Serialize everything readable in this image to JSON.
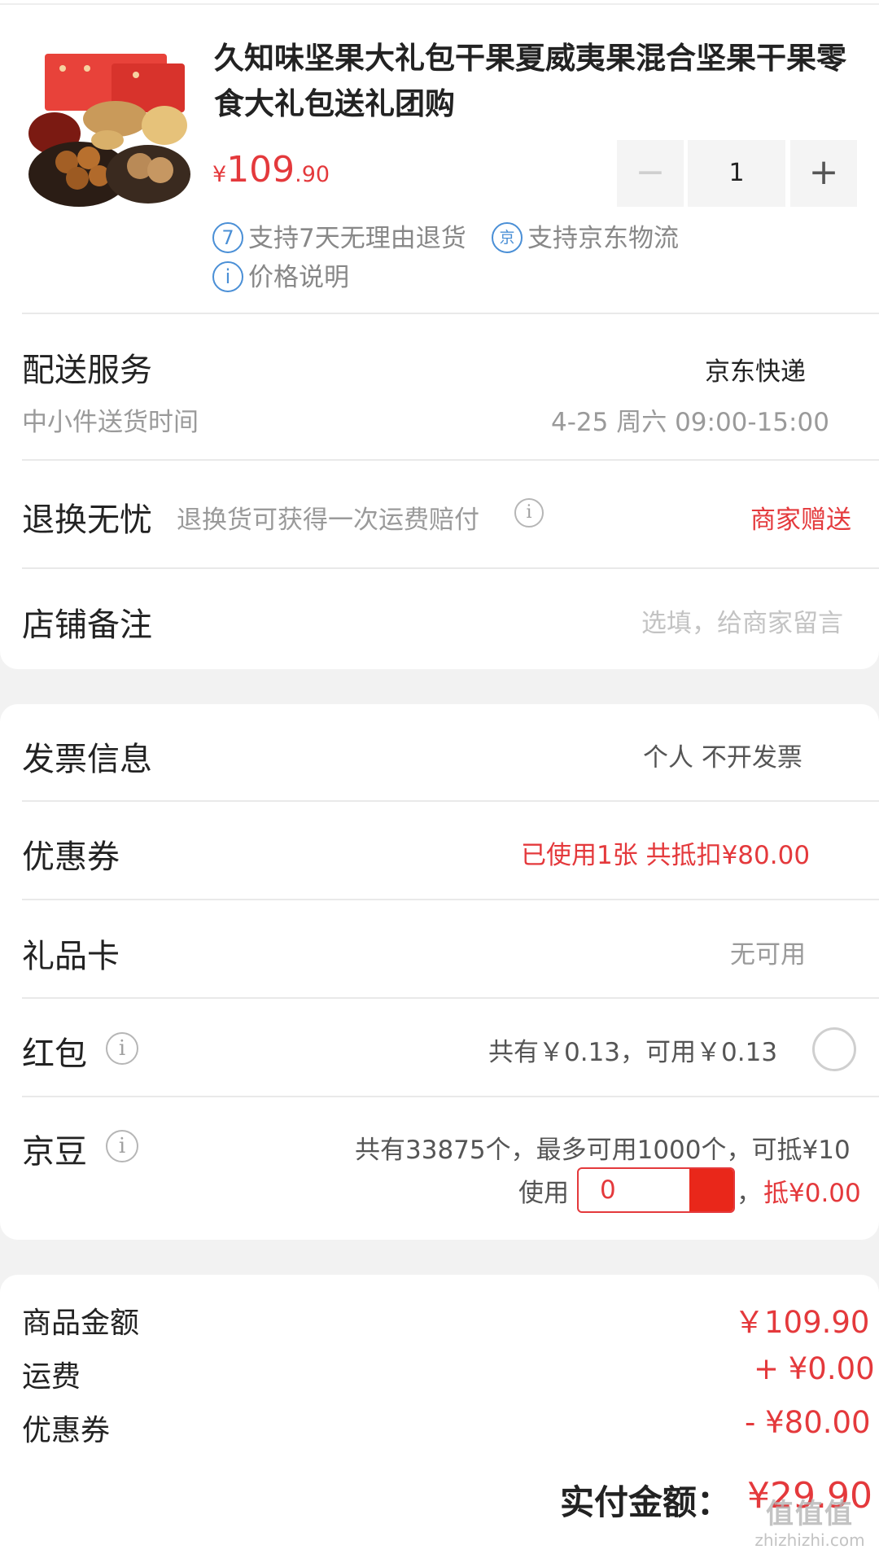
{
  "product": {
    "title": "久知味坚果大礼包干果夏威夷果混合坚果干果零食大礼包送礼团购",
    "price_symbol": "¥",
    "price_int": "109",
    "price_dec": ".90",
    "quantity": "1",
    "minus_label": "−",
    "plus_label": "+",
    "badges": [
      {
        "icon": "7",
        "text": "支持7天无理由退货"
      },
      {
        "icon": "京",
        "text": "支持京东物流"
      },
      {
        "icon": "i",
        "text": "价格说明"
      }
    ]
  },
  "delivery": {
    "label": "配送服务",
    "value": "京东快递",
    "sub_label": "中小件送货时间",
    "sub_value": "4-25 周六 09:00-15:00"
  },
  "return": {
    "label": "退换无忧",
    "desc": "退换货可获得一次运费赔付",
    "value": "商家赠送"
  },
  "note": {
    "label": "店铺备注",
    "placeholder": "选填，给商家留言"
  },
  "invoice": {
    "label": "发票信息",
    "value": "个人 不开发票"
  },
  "coupon": {
    "label": "优惠券",
    "value": "已使用1张 共抵扣¥80.00"
  },
  "giftcard": {
    "label": "礼品卡",
    "value": "无可用"
  },
  "redpacket": {
    "label": "红包",
    "value": "共有￥0.13，可用￥0.13"
  },
  "jingdou": {
    "label": "京豆",
    "desc": "共有33875个，最多可用1000个，可抵¥10",
    "use_label": "使用",
    "input_value": "0",
    "comma": "，",
    "deduct": "抵¥0.00"
  },
  "summary": {
    "rows": [
      {
        "label": "商品金额",
        "value": "￥109.90"
      },
      {
        "label": "运费",
        "value": "+ ¥0.00"
      },
      {
        "label": "优惠券",
        "value": "- ¥80.00"
      }
    ],
    "pay_label": "实付金额：",
    "pay_value": "¥29.90"
  },
  "watermark": {
    "big": "值值值",
    "small": "zhizhizhi.com"
  },
  "colors": {
    "accent": "#e4393c",
    "badge_blue": "#4a8fd6",
    "background": "#f2f2f2"
  }
}
